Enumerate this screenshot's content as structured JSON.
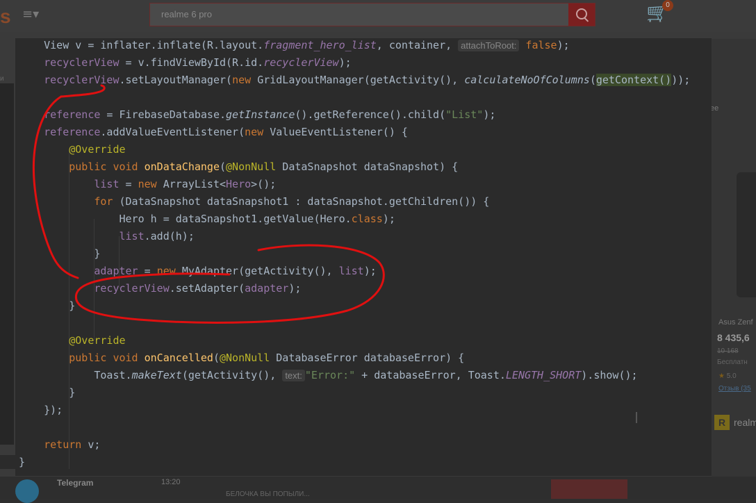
{
  "background_page": {
    "logo_text": "s",
    "search_value": "realme 6 pro",
    "cart_count": "0",
    "left_label": "и",
    "right_ee": "ee",
    "product_name": "Asus Zenf",
    "product_price": "8 435,6",
    "product_old_price": "10 168",
    "product_shipping": "Бесплатн",
    "product_rating": "5.0",
    "product_reviews": "Отзыв (35",
    "brand_badge": "R",
    "brand_text": "realm",
    "telegram_name": "Telegram",
    "telegram_time": "13:20",
    "telegram_msg": "БЕЛОЧКА ВЫ ПОПЫЛИ..."
  },
  "editor": {
    "lines": [
      {
        "segments": [
          {
            "t": "    View v = inflater.inflate(R.layout.",
            "c": ""
          },
          {
            "t": "fragment_hero_list",
            "c": "fld ital"
          },
          {
            "t": ", container, ",
            "c": ""
          },
          {
            "t": "attachToRoot:",
            "c": "hint"
          },
          {
            "t": " ",
            "c": ""
          },
          {
            "t": "false",
            "c": "kw"
          },
          {
            "t": ");",
            "c": ""
          }
        ]
      },
      {
        "segments": [
          {
            "t": "    ",
            "c": ""
          },
          {
            "t": "recyclerView",
            "c": "fld"
          },
          {
            "t": " = v.findViewById(R.id.",
            "c": ""
          },
          {
            "t": "recyclerView",
            "c": "fld ital"
          },
          {
            "t": ");",
            "c": ""
          }
        ]
      },
      {
        "segments": [
          {
            "t": "    ",
            "c": ""
          },
          {
            "t": "recyclerView",
            "c": "fld"
          },
          {
            "t": ".setLayoutManager(",
            "c": ""
          },
          {
            "t": "new ",
            "c": "kw"
          },
          {
            "t": "GridLayoutManager(getActivity(), ",
            "c": ""
          },
          {
            "t": "calculateNoOfColumns",
            "c": "ital"
          },
          {
            "t": "(",
            "c": ""
          },
          {
            "t": "getContext()",
            "c": "hl"
          },
          {
            "t": "));",
            "c": ""
          }
        ]
      },
      {
        "segments": []
      },
      {
        "segments": [
          {
            "t": "    ",
            "c": ""
          },
          {
            "t": "reference",
            "c": "fld"
          },
          {
            "t": " = FirebaseDatabase.",
            "c": ""
          },
          {
            "t": "getInstance",
            "c": "ital"
          },
          {
            "t": "().getReference().child(",
            "c": ""
          },
          {
            "t": "\"List\"",
            "c": "str"
          },
          {
            "t": ");",
            "c": ""
          }
        ]
      },
      {
        "segments": [
          {
            "t": "    ",
            "c": ""
          },
          {
            "t": "reference",
            "c": "fld"
          },
          {
            "t": ".addValueEventListener(",
            "c": ""
          },
          {
            "t": "new ",
            "c": "kw"
          },
          {
            "t": "ValueEventListener() {",
            "c": ""
          }
        ]
      },
      {
        "segments": [
          {
            "t": "        ",
            "c": ""
          },
          {
            "t": "@Override",
            "c": "ann"
          }
        ]
      },
      {
        "segments": [
          {
            "t": "        ",
            "c": ""
          },
          {
            "t": "public void ",
            "c": "kw"
          },
          {
            "t": "onDataChange",
            "c": "mth"
          },
          {
            "t": "(",
            "c": ""
          },
          {
            "t": "@NonNull",
            "c": "ann"
          },
          {
            "t": " DataSnapshot dataSnapshot) {",
            "c": ""
          }
        ]
      },
      {
        "segments": [
          {
            "t": "            ",
            "c": ""
          },
          {
            "t": "list",
            "c": "fld"
          },
          {
            "t": " = ",
            "c": ""
          },
          {
            "t": "new ",
            "c": "kw"
          },
          {
            "t": "ArrayList<",
            "c": ""
          },
          {
            "t": "Hero",
            "c": "fld"
          },
          {
            "t": ">();",
            "c": ""
          }
        ]
      },
      {
        "segments": [
          {
            "t": "            ",
            "c": ""
          },
          {
            "t": "for ",
            "c": "kw"
          },
          {
            "t": "(DataSnapshot dataSnapshot1 : dataSnapshot.getChildren()) {",
            "c": ""
          }
        ]
      },
      {
        "segments": [
          {
            "t": "                Hero h = dataSnapshot1.getValue(Hero.",
            "c": ""
          },
          {
            "t": "class",
            "c": "kw"
          },
          {
            "t": ");",
            "c": ""
          }
        ]
      },
      {
        "segments": [
          {
            "t": "                ",
            "c": ""
          },
          {
            "t": "list",
            "c": "fld"
          },
          {
            "t": ".add(h);",
            "c": ""
          }
        ]
      },
      {
        "segments": [
          {
            "t": "            }",
            "c": ""
          }
        ]
      },
      {
        "segments": [
          {
            "t": "            ",
            "c": ""
          },
          {
            "t": "adapter",
            "c": "fld"
          },
          {
            "t": " = ",
            "c": ""
          },
          {
            "t": "new ",
            "c": "kw"
          },
          {
            "t": "MyAdapter(getActivity(), ",
            "c": ""
          },
          {
            "t": "list",
            "c": "fld"
          },
          {
            "t": ");",
            "c": ""
          }
        ]
      },
      {
        "segments": [
          {
            "t": "            ",
            "c": ""
          },
          {
            "t": "recyclerView",
            "c": "fld"
          },
          {
            "t": ".setAdapter(",
            "c": ""
          },
          {
            "t": "adapter",
            "c": "fld"
          },
          {
            "t": ");",
            "c": ""
          }
        ]
      },
      {
        "segments": [
          {
            "t": "        }",
            "c": ""
          }
        ]
      },
      {
        "segments": []
      },
      {
        "segments": [
          {
            "t": "        ",
            "c": ""
          },
          {
            "t": "@Override",
            "c": "ann"
          }
        ]
      },
      {
        "segments": [
          {
            "t": "        ",
            "c": ""
          },
          {
            "t": "public void ",
            "c": "kw"
          },
          {
            "t": "onCancelled",
            "c": "mth"
          },
          {
            "t": "(",
            "c": ""
          },
          {
            "t": "@NonNull",
            "c": "ann"
          },
          {
            "t": " DatabaseError databaseError) {",
            "c": ""
          }
        ]
      },
      {
        "segments": [
          {
            "t": "            Toast.",
            "c": ""
          },
          {
            "t": "makeText",
            "c": "ital"
          },
          {
            "t": "(getActivity(), ",
            "c": ""
          },
          {
            "t": "text:",
            "c": "hint"
          },
          {
            "t": "\"Error:\"",
            "c": "str"
          },
          {
            "t": " + databaseError, Toast.",
            "c": ""
          },
          {
            "t": "LENGTH_SHORT",
            "c": "fld ital"
          },
          {
            "t": ").show();",
            "c": ""
          }
        ]
      },
      {
        "segments": [
          {
            "t": "        }",
            "c": ""
          }
        ]
      },
      {
        "segments": [
          {
            "t": "    });",
            "c": ""
          }
        ]
      },
      {
        "segments": []
      },
      {
        "segments": [
          {
            "t": "    ",
            "c": ""
          },
          {
            "t": "return ",
            "c": "kw"
          },
          {
            "t": "v;",
            "c": ""
          }
        ]
      },
      {
        "segments": [
          {
            "t": "}",
            "c": ""
          }
        ]
      }
    ]
  },
  "annotation_color": "#e01010",
  "colors": {
    "editor_bg": "#2b2b2b",
    "keyword": "#cc7832",
    "field": "#9876aa",
    "string": "#6a8759",
    "annotation": "#bbb529",
    "method": "#ffc66d",
    "plain": "#a9b7c6"
  }
}
